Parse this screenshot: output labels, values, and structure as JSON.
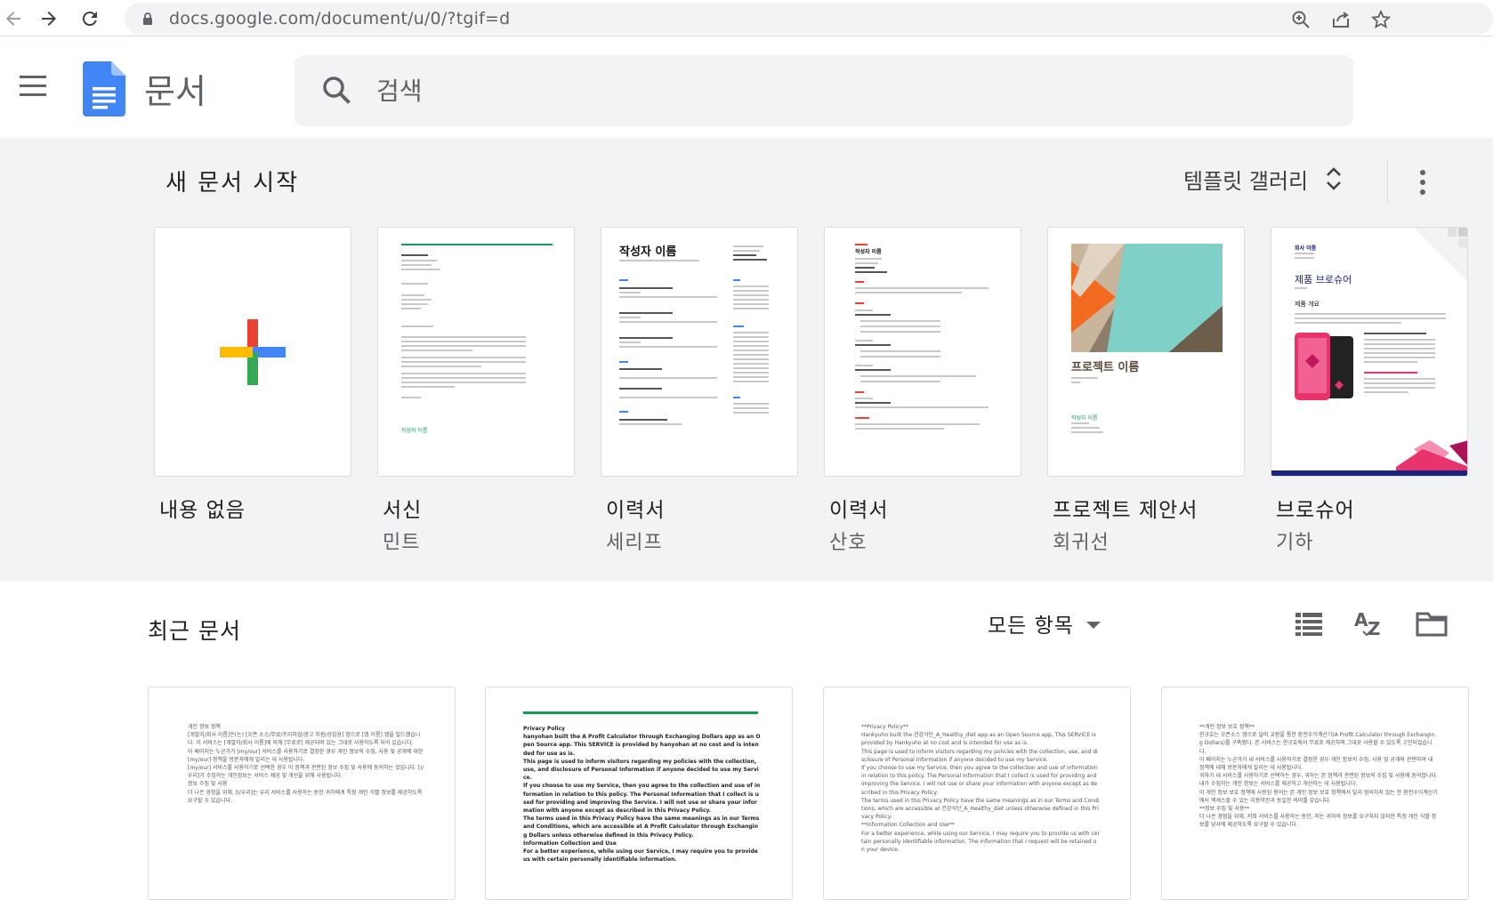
{
  "browser": {
    "url": "docs.google.com/document/u/0/?tgif=d",
    "icons": [
      "back-arrow-icon",
      "forward-arrow-icon",
      "reload-icon",
      "lock-icon",
      "zoom-icon",
      "share-icon",
      "star-icon"
    ]
  },
  "header": {
    "app_title": "문서",
    "search_placeholder": "검색",
    "icons": [
      "menu-icon",
      "docs-logo-icon",
      "search-icon"
    ]
  },
  "templates": {
    "section_title": "새 문서 시작",
    "gallery_label": "템플릿 갤러리",
    "items": [
      {
        "name": "내용 없음",
        "subtitle": ""
      },
      {
        "name": "서신",
        "subtitle": "민트"
      },
      {
        "name": "이력서",
        "subtitle": "세리프"
      },
      {
        "name": "이력서",
        "subtitle": "산호"
      },
      {
        "name": "프로젝트 제안서",
        "subtitle": "회귀선"
      },
      {
        "name": "브로슈어",
        "subtitle": "기하"
      }
    ],
    "thumbnails": {
      "letter_signoff": "작성자 이름",
      "resume_serif_name": "작성자 이름",
      "resume_coral_name": "작성자 이름",
      "proposal_title": "프로젝트 이름",
      "proposal_author": "작성자 이름",
      "brochure_company": "회사 이름",
      "brochure_title": "제품 브로슈어",
      "brochure_overview": "제품 개요"
    }
  },
  "recent": {
    "section_title": "최근 문서",
    "owner_filter": "모든 항목",
    "documents": [
      {
        "preview": "개인 정보 정책\n[개발자/회사 이름]은(는) [오픈 소스/무료/프리미엄/광고 지원/상업용] 앱으로 [앱 이름] 앱을 빌드했습니다. 이 서비스는 [개발자/회사 이름]에 의해 [무료로] 제공되며 있는 그대로 사용하도록 되어 있습니다.\n이 페이지는 누군가가 [my/our] 서비스를 사용하기로 결정한 경우 개인 정보의 수집, 사용 및 공개에 대한 [my/our] 정책을 방문자에게 알리는 데 사용됩니다.\n[my/our] 서비스를 사용하기로 선택한 경우 이 정책과 관련된 정보 수집 및 사용에 동의하는 것입니다. [I/우리]가 수집하는 개인정보는 서비스 제공 및 개선을 위해 사용됩니다.\n정보 수집 및 사용\n더 나은 경험을 위해, [I/우리]는 우리 서비스를 사용하는 동안 귀하에게 특정 개인 식별 정보를 제공하도록 요구할 수 있습니다."
      },
      {
        "preview": "Privacy Policy\nhanyohan built the A Profit Calculator through Exchanging Dollars app as an Open Source app. This SERVICE is provided by hanyohan at no cost and is intended for use as is.\nThis page is used to inform visitors regarding my policies with the collection, use, and disclosure of Personal Information if anyone decided to use my Service.\nIf you choose to use my Service, then you agree to the collection and use of information in relation to this policy. The Personal Information that I collect is used for providing and improving the Service. I will not use or share your information with anyone except as described in this Privacy Policy.\nThe terms used in this Privacy Policy have the same meanings as in our Terms and Conditions, which are accessible at A Profit Calculator through Exchanging Dollars unless otherwise defined in this Privacy Policy.\nInformation Collection and Use\nFor a better experience, while using our Service, I may require you to provide us with certain personally identifiable information."
      },
      {
        "preview": "**Privacy Policy**\nHankyuho built the 건강식단_A_Healthy_diet app as an Open Source app. This SERVICE is provided by Hankyuho at no cost and is intended for use as is.\nThis page is used to inform visitors regarding my policies with the collection, use, and disclosure of Personal Information if anyone decided to use my Service.\nIf you choose to use my Service, then you agree to the collection and use of information in relation to this policy. The Personal Information that I collect is used for providing and improving the Service. I will not use or share your information with anyone except as described in this Privacy Policy.\nThe terms used in this Privacy Policy have the same meanings as in our Terms and Conditions, which are accessible at 건강식단_A_Healthy_diet unless otherwise defined in this Privacy Policy.\n**Information Collection and Use**\nFor a better experience, while using our Service, I may require you to provide us with certain personally identifiable information. The information that I request will be retained on your device."
      },
      {
        "preview": "**개인 정보 보호 정책**\n한규호는 오픈소스 앱으로 달러 교환을 통한 환전수익계산기(A Profit Calculator through Exchanging Dollars)를 구축했다. 본 서비스는 한규호에서 무료로 제공하며 그대로 사용할 수 있도록 고안되었습니다.\n이 페이지는 누군가가 내 서비스를 사용하기로 결정한 경우 개인 정보의 수집, 사용 및 공개와 관련하여 내 정책에 대해 방문자에게 알리는 데 사용됩니다.\n귀하가 내 서비스를 사용하기로 선택하는 경우, 귀하는 본 정책과 관련된 정보의 수집 및 사용에 동의합니다. 내가 수집하는 개인 정보는 서비스를 제공하고 개선하는 데 사용됩니다.\n이 개인 정보 보호 정책에 사용된 용어는 본 개인 정보 보호 정책에서 달리 정의하지 않는 한 환전수익계산기에서 액세스할 수 있는 이용약관과 동일한 의미를 갖습니다.\n**정보 수집 및 사용**\n더 나은 경험을 위해, 저희 서비스를 사용하는 동안, 저는 귀하의 정보를 요구하지 않지만 특정 개인 식별 정보를 당사에 제공하도록 요구할 수 있습니다."
      }
    ]
  },
  "colors": {
    "docs_blue": "#4285f4",
    "panel_gray": "#f1f3f4",
    "mint": "#0f9d58",
    "coral": "#e94235",
    "brochure_pink": "#e8336d",
    "brochure_navy": "#1a237e"
  }
}
